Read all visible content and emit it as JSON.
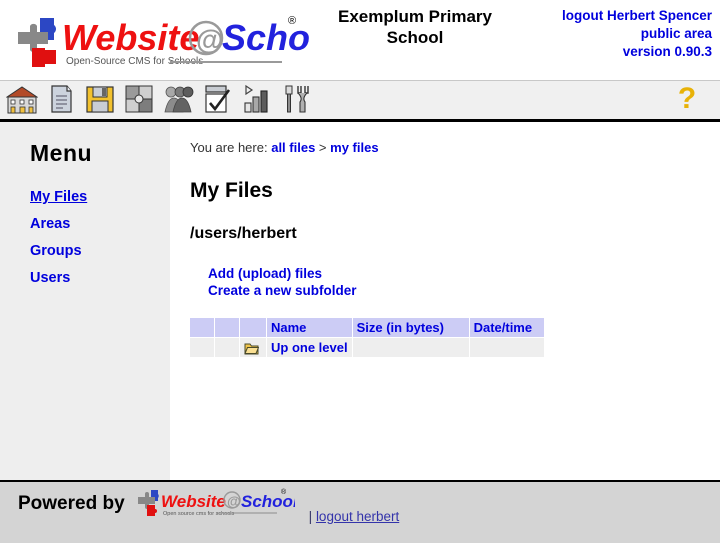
{
  "header": {
    "logo_text_1": "Website",
    "logo_at": "@",
    "logo_text_2": "School",
    "logo_tagline": "Open-Source CMS for Schools",
    "logo_registered": "®",
    "school_title": "Exemplum Primary School",
    "logout_link": "logout Herbert Spencer",
    "area_label": "public area",
    "version_label": "version 0.90.3"
  },
  "toolbar": {
    "icons": [
      {
        "name": "school-home-icon",
        "label": "Home"
      },
      {
        "name": "page-icon",
        "label": "Pages"
      },
      {
        "name": "floppy-save-icon",
        "label": "Save"
      },
      {
        "name": "puzzle-modules-icon",
        "label": "Modules"
      },
      {
        "name": "users-faces-icon",
        "label": "Users"
      },
      {
        "name": "checklist-icon",
        "label": "Tasks"
      },
      {
        "name": "bar-chart-icon",
        "label": "Statistics"
      },
      {
        "name": "tools-icon",
        "label": "Tools"
      }
    ],
    "help_icon": "?"
  },
  "sidebar": {
    "title": "Menu",
    "items": [
      {
        "label": "My Files",
        "active": true
      },
      {
        "label": "Areas",
        "active": false
      },
      {
        "label": "Groups",
        "active": false
      },
      {
        "label": "Users",
        "active": false
      }
    ]
  },
  "main": {
    "breadcrumb_prefix": "You are here:",
    "breadcrumb": [
      {
        "label": "all files"
      },
      {
        "label": "my files"
      }
    ],
    "breadcrumb_separator": ">",
    "title": "My Files",
    "path": "/users/herbert",
    "actions": [
      {
        "label": "Add (upload) files"
      },
      {
        "label": "Create a new subfolder"
      }
    ],
    "table": {
      "columns": [
        "",
        "",
        "",
        "Name",
        "Size (in bytes)",
        "Date/time"
      ],
      "rows": [
        {
          "col1": "",
          "col2": "",
          "icon": "folder-icon",
          "name": "Up one level",
          "size": "",
          "datetime": ""
        }
      ]
    }
  },
  "footer": {
    "powered_by": "Powered by",
    "logo_text_1": "Website",
    "logo_at": "@",
    "logo_text_2": "School",
    "logo_tagline": "Open source cms for schools",
    "logo_registered": "®",
    "separator": "|",
    "logout_link": "logout herbert"
  },
  "colors": {
    "link_blue": "#0000dd",
    "logo_red": "#ee1111",
    "logo_blue": "#2222dd",
    "table_header": "#ccccf5",
    "table_row": "#eeeeee",
    "sidebar_bg": "#eeeeee",
    "footer_bg": "#d4d4d4",
    "help_yellow": "#e8b208"
  }
}
